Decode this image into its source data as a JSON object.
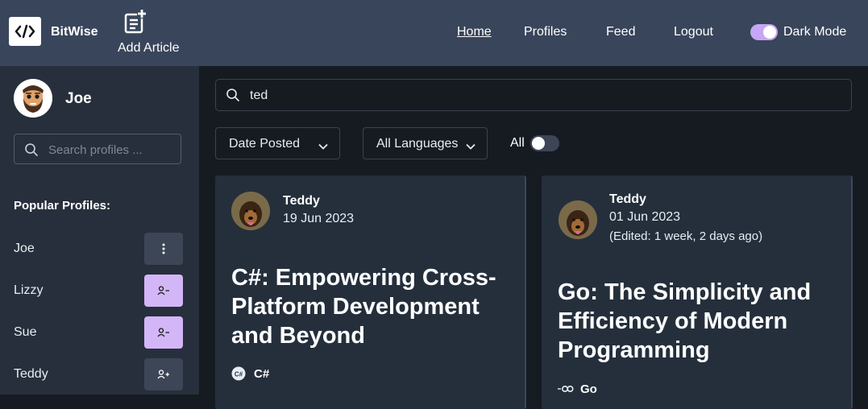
{
  "navbar": {
    "brand": "BitWise",
    "add_article": "Add Article",
    "links": [
      "Home",
      "Profiles",
      "Feed",
      "Logout"
    ],
    "dark_mode_label": "Dark Mode",
    "dark_mode_on": true
  },
  "sidebar": {
    "username": "Joe",
    "search_placeholder": "Search profiles ...",
    "popular_title": "Popular Profiles:",
    "profiles": [
      {
        "name": "Joe",
        "action_icon": "more-vertical-icon"
      },
      {
        "name": "Lizzy",
        "action_icon": "unfollow-user-icon"
      },
      {
        "name": "Sue",
        "action_icon": "unfollow-user-icon"
      },
      {
        "name": "Teddy",
        "action_icon": "follow-user-icon"
      }
    ]
  },
  "main": {
    "search_value": "ted",
    "sort_label": "Date Posted",
    "language_label": "All Languages",
    "all_label": "All",
    "all_toggle_on": false
  },
  "articles": [
    {
      "author": "Teddy",
      "date": "19 Jun 2023",
      "edited": "",
      "title": "C#: Empowering Cross-Platform Development and Beyond",
      "language": "C#",
      "language_icon": "csharp-icon"
    },
    {
      "author": "Teddy",
      "date": "01 Jun 2023",
      "edited": "(Edited: 1 week, 2 days ago)",
      "title": "Go: The Simplicity and Efficiency of Modern Programming",
      "language": "Go",
      "language_icon": "go-icon"
    }
  ],
  "colors": {
    "navbar": "#39455a",
    "sidebar": "#272f3c",
    "background": "#161b22",
    "card": "#252f3c",
    "accent": "#d3b6f7"
  }
}
